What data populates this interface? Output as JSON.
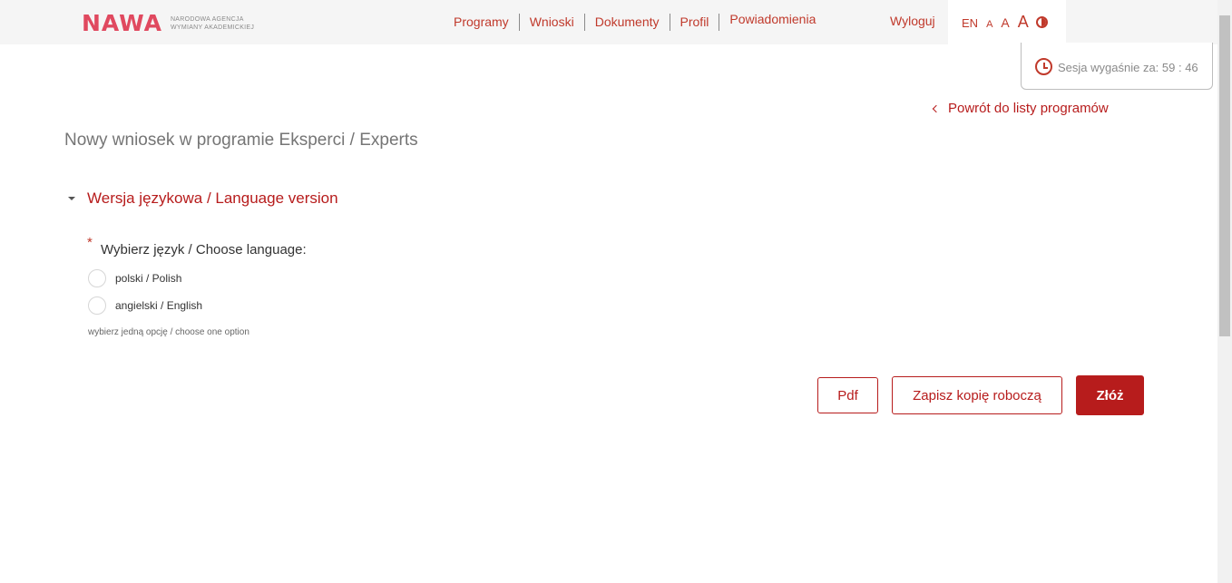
{
  "header": {
    "logo": {
      "mark": "NAWA",
      "sub_line1": "NARODOWA AGENCJA",
      "sub_line2": "WYMIANY AKADEMICKIEJ"
    },
    "nav": [
      {
        "label": "Programy"
      },
      {
        "label": "Wnioski"
      },
      {
        "label": "Dokumenty"
      },
      {
        "label": "Profil"
      },
      {
        "label": "Powiadomienia"
      }
    ],
    "logout_label": "Wyloguj",
    "accessibility": {
      "language": "EN",
      "font_small": "A",
      "font_medium": "A",
      "font_large": "A",
      "contrast_icon": "contrast-icon"
    }
  },
  "session": {
    "icon": "clock-icon",
    "label": "Sesja wygaśnie za:",
    "time": "59 : 46"
  },
  "main": {
    "back_link": "Powrót do listy programów",
    "page_title": "Nowy wniosek w programie Eksperci / Experts",
    "section": {
      "title": "Wersja językowa / Language version",
      "required_mark": "*",
      "question": "Wybierz język / Choose language:",
      "options": [
        {
          "label": "polski / Polish",
          "selected": false
        },
        {
          "label": "angielski / English",
          "selected": false
        }
      ],
      "hint": "wybierz jedną opcję / choose one option"
    },
    "actions": {
      "pdf": "Pdf",
      "save_draft": "Zapisz kopię roboczą",
      "submit": "Złóż"
    }
  },
  "colors": {
    "accent": "#b71c1c",
    "link": "#c0392b",
    "logo": "#e0495f",
    "header_bg": "#f5f5f5"
  }
}
